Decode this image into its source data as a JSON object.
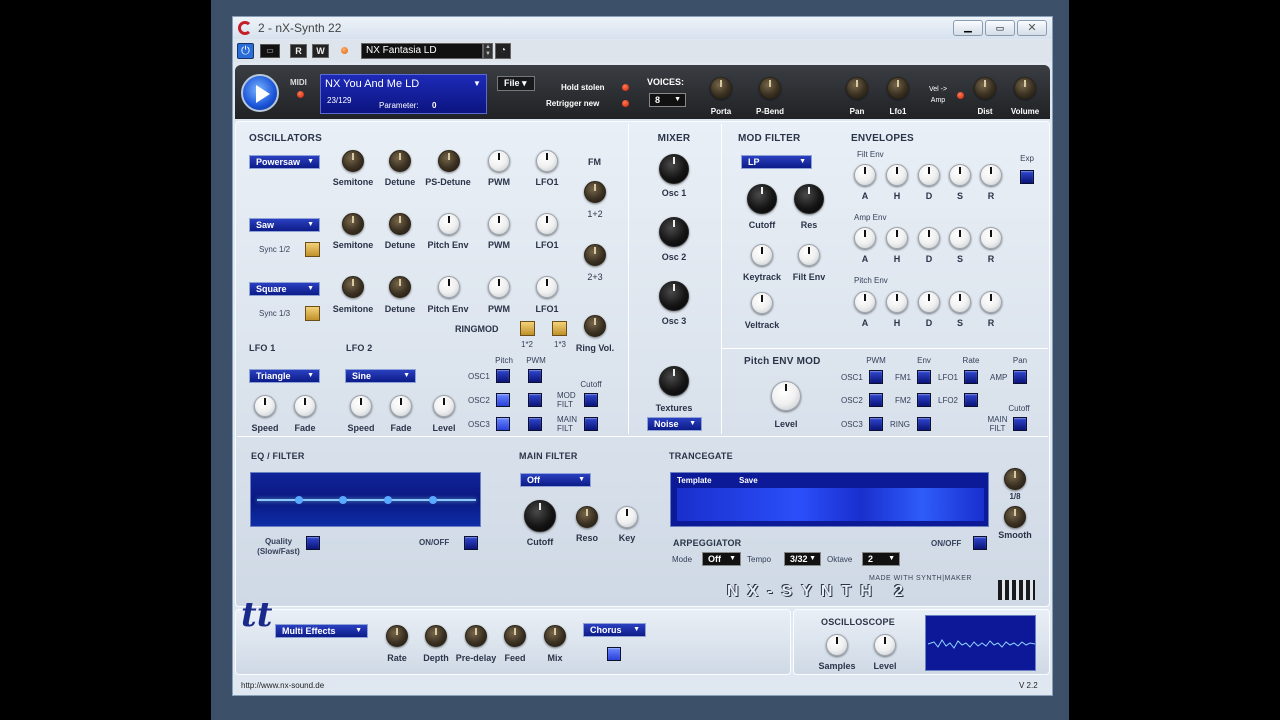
{
  "window": {
    "title": "2 - nX-Synth 22"
  },
  "toolbar": {
    "r": "R",
    "w": "W",
    "preset": "NX Fantasia LD"
  },
  "topbar": {
    "midi": "MIDI",
    "patch_name": "NX You And Me LD",
    "patch_count": "23/129",
    "parameter_label": "Parameter:",
    "parameter_value": "0",
    "file": "File",
    "hold_stolen": "Hold stolen",
    "retrigger_new": "Retrigger new",
    "voices_label": "VOICES:",
    "voices_value": "8",
    "porta": "Porta",
    "pbend": "P-Bend",
    "pan": "Pan",
    "lfo1": "Lfo1",
    "vel_amp": "Vel -> Amp",
    "dist": "Dist",
    "volume": "Volume"
  },
  "osc": {
    "title": "OSCILLATORS",
    "wave1": "Powersaw",
    "wave2": "Saw",
    "wave3": "Square",
    "semitone": "Semitone",
    "detune": "Detune",
    "psdetune": "PS-Detune",
    "pitchenv": "Pitch Env",
    "pwm": "PWM",
    "lfo1": "LFO1",
    "fm": "FM",
    "fm12": "1+2",
    "fm23": "2+3",
    "sync12": "Sync 1/2",
    "sync13": "Sync 1/3",
    "ringmod": "RINGMOD",
    "r12": "1*2",
    "r13": "1*3",
    "ringvol": "Ring Vol."
  },
  "lfo": {
    "lfo1": "LFO 1",
    "lfo2": "LFO 2",
    "wave1": "Triangle",
    "wave2": "Sine",
    "speed": "Speed",
    "fade": "Fade",
    "level": "Level",
    "pitch": "Pitch",
    "pwm": "PWM",
    "cutoff": "Cutoff",
    "osc1": "OSC1",
    "osc2": "OSC2",
    "osc3": "OSC3",
    "modfilt": "MOD FILT",
    "mainfilt": "MAIN FILT"
  },
  "mixer": {
    "title": "MIXER",
    "osc1": "Osc 1",
    "osc2": "Osc 2",
    "osc3": "Osc 3",
    "textures": "Textures",
    "noise": "Noise"
  },
  "modfilter": {
    "title": "MOD FILTER",
    "type": "LP",
    "cutoff": "Cutoff",
    "res": "Res",
    "keytrack": "Keytrack",
    "filtenv": "Filt Env",
    "veltrack": "Veltrack"
  },
  "env": {
    "title": "ENVELOPES",
    "filt": "Filt Env",
    "amp": "Amp Env",
    "pitch": "Pitch Env",
    "exp": "Exp",
    "a": "A",
    "h": "H",
    "d": "D",
    "s": "S",
    "r": "R"
  },
  "pitchmod": {
    "title": "Pitch ENV MOD",
    "level": "Level",
    "pwm": "PWM",
    "env": "Env",
    "rate": "Rate",
    "pan": "Pan",
    "osc1": "OSC1",
    "osc2": "OSC2",
    "osc3": "OSC3",
    "fm1": "FM1",
    "fm2": "FM2",
    "ring": "RING",
    "lfo1": "LFO1",
    "lfo2": "LFO2",
    "amp": "AMP",
    "cutoff": "Cutoff",
    "mainfilt": "MAIN FILT"
  },
  "eq": {
    "title": "EQ / FILTER",
    "quality": "Quality (Slow/Fast)",
    "onoff": "ON/OFF"
  },
  "mainfilter": {
    "title": "MAIN FILTER",
    "type": "Off",
    "cutoff": "Cutoff",
    "reso": "Reso",
    "key": "Key"
  },
  "trance": {
    "title": "TRANCEGATE",
    "template": "Template",
    "save": "Save",
    "rate": "1/8",
    "smooth": "Smooth",
    "onoff": "ON/OFF"
  },
  "arp": {
    "title": "ARPEGGIATOR",
    "mode": "Mode",
    "mode_val": "Off",
    "tempo": "Tempo",
    "tempo_val": "3/32",
    "oktave": "Oktave",
    "oktave_val": "2"
  },
  "brand": {
    "made": "MADE WITH SYNTH|MAKER",
    "logo": "NX-SYNTH 2"
  },
  "fx": {
    "type": "Multi Effects",
    "effect": "Chorus",
    "rate": "Rate",
    "depth": "Depth",
    "predelay": "Pre-delay",
    "feed": "Feed",
    "mix": "Mix"
  },
  "scope": {
    "title": "OSCILLOSCOPE",
    "samples": "Samples",
    "level": "Level"
  },
  "footer": {
    "url": "http://www.nx-sound.de",
    "version": "V 2.2"
  }
}
